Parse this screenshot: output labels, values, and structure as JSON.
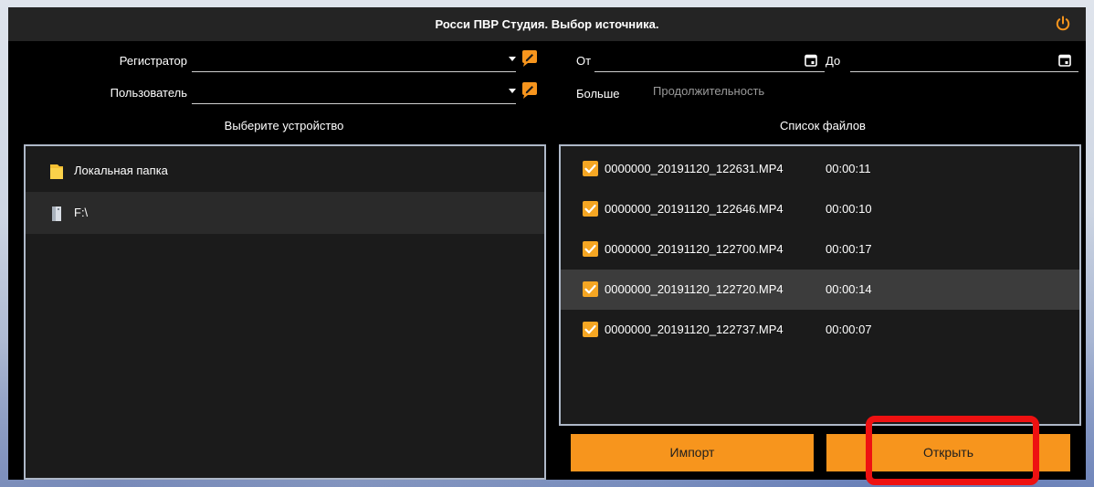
{
  "window": {
    "title": "Росси ПВР Студия. Выбор источника.",
    "accent": "#f7951d",
    "power_icon": "power-icon"
  },
  "left": {
    "registrar_label": "Регистратор",
    "registrar_value": "",
    "user_label": "Пользователь",
    "user_value": "",
    "device_header": "Выберите устройство",
    "devices": [
      {
        "label": "Локальная папка",
        "icon": "folder-icon"
      },
      {
        "label": "F:\\",
        "icon": "drive-icon"
      }
    ]
  },
  "right": {
    "from_label": "От",
    "from_value": "",
    "to_label": "До",
    "to_value": "",
    "more_label": "Больше",
    "duration_label": "Продолжительность",
    "files_header": "Список файлов",
    "files": [
      {
        "name": "0000000_20191120_122631.MP4",
        "duration": "00:00:11",
        "checked": true
      },
      {
        "name": "0000000_20191120_122646.MP4",
        "duration": "00:00:10",
        "checked": true
      },
      {
        "name": "0000000_20191120_122700.MP4",
        "duration": "00:00:17",
        "checked": true
      },
      {
        "name": "0000000_20191120_122720.MP4",
        "duration": "00:00:14",
        "checked": true
      },
      {
        "name": "0000000_20191120_122737.MP4",
        "duration": "00:00:07",
        "checked": true
      }
    ]
  },
  "buttons": {
    "import_label": "Импорт",
    "open_label": "Открыть"
  }
}
